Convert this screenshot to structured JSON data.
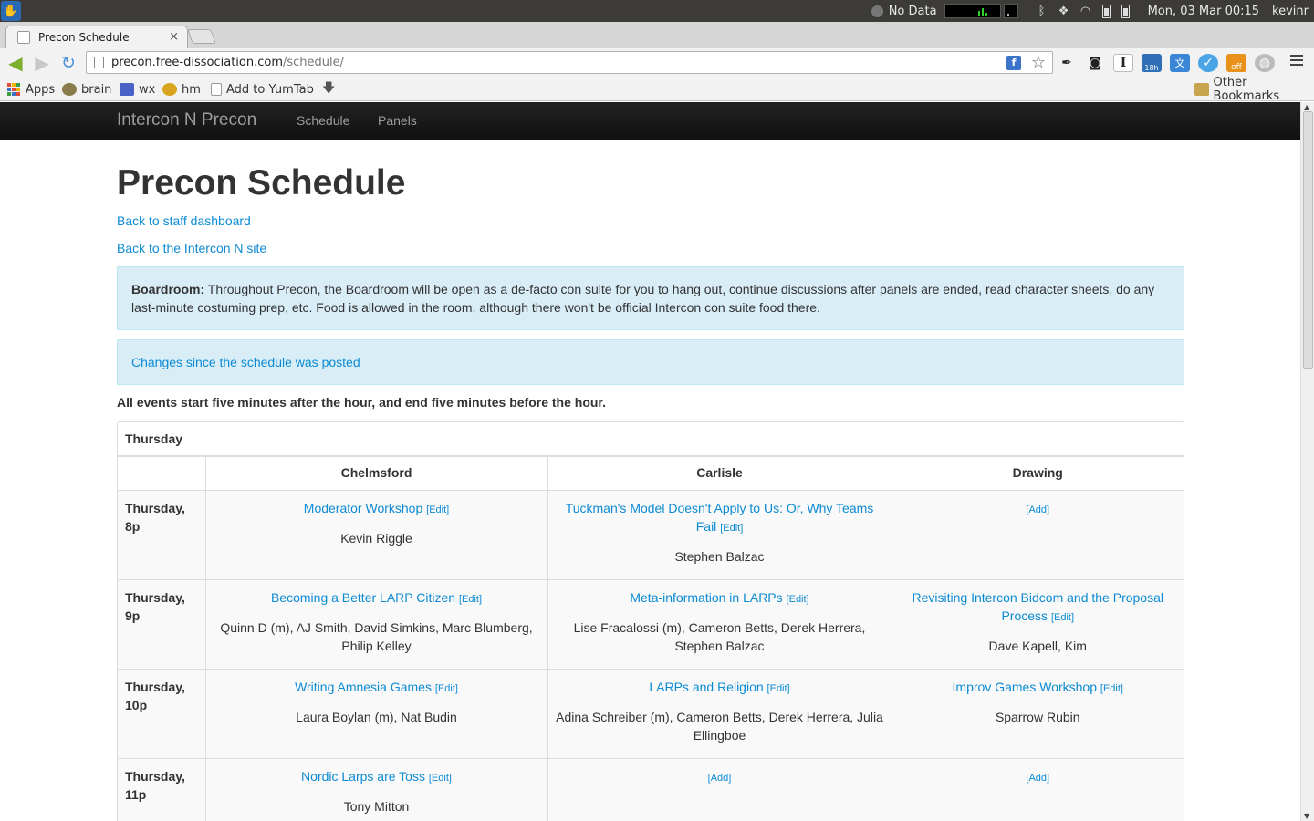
{
  "os_panel": {
    "network_label": "No Data",
    "clock": "Mon, 03 Mar  00:15",
    "user": "kevinr"
  },
  "browser": {
    "tab_title": "Precon Schedule",
    "tab_close": "×",
    "url_host": "precon.free-dissociation.com",
    "url_path": "/schedule/",
    "bookmarks": [
      {
        "label": "Apps",
        "icon": "apps-grid-icon"
      },
      {
        "label": "brain",
        "icon": "brain-icon"
      },
      {
        "label": "wx",
        "icon": "wx-icon"
      },
      {
        "label": "hm",
        "icon": "hm-icon"
      },
      {
        "label": "Add to YumTab",
        "icon": "page-icon"
      }
    ],
    "other_bookmarks": "Other Bookmarks",
    "ext_badges": {
      "calendar": "18h",
      "off": "off"
    }
  },
  "site": {
    "brand": "Intercon N Precon",
    "nav": [
      "Schedule",
      "Panels"
    ]
  },
  "page": {
    "title": "Precon Schedule",
    "back_dashboard": "Back to staff dashboard",
    "back_site": "Back to the Intercon N site",
    "boardroom_label": "Boardroom:",
    "boardroom_text": " Throughout Precon, the Boardroom will be open as a de-facto con suite for you to hang out, continue discussions after panels are ended, read character sheets, do any last-minute costuming prep, etc. Food is allowed in the room, although there won't be official Intercon con suite food there.",
    "changes_link": "Changes since the schedule was posted",
    "note": "All events start five minutes after the hour, and end five minutes before the hour."
  },
  "schedule": {
    "day": "Thursday",
    "rooms": [
      "Chelmsford",
      "Carlisle",
      "Drawing"
    ],
    "edit_label": "[Edit]",
    "add_label": "[Add]",
    "rows": [
      {
        "time_day": "Thursday,",
        "time_hour": "8p",
        "cells": [
          {
            "title": "Moderator Workshop",
            "people": "Kevin Riggle"
          },
          {
            "title": "Tuckman's Model Doesn't Apply to Us: Or, Why Teams Fail",
            "people": "Stephen Balzac"
          },
          null
        ]
      },
      {
        "time_day": "Thursday,",
        "time_hour": "9p",
        "cells": [
          {
            "title": "Becoming a Better LARP Citizen",
            "people": "Quinn D (m), AJ Smith, David Simkins, Marc Blumberg, Philip Kelley"
          },
          {
            "title": "Meta-information in LARPs",
            "people": "Lise Fracalossi (m), Cameron Betts, Derek Herrera, Stephen Balzac"
          },
          {
            "title": "Revisiting Intercon Bidcom and the Proposal Process",
            "people": "Dave Kapell, Kim"
          }
        ]
      },
      {
        "time_day": "Thursday,",
        "time_hour": "10p",
        "cells": [
          {
            "title": "Writing Amnesia Games",
            "people": "Laura Boylan (m), Nat Budin"
          },
          {
            "title": "LARPs and Religion",
            "people": "Adina Schreiber (m), Cameron Betts, Derek Herrera, Julia Ellingboe"
          },
          {
            "title": "Improv Games Workshop",
            "people": "Sparrow Rubin"
          }
        ]
      },
      {
        "time_day": "Thursday,",
        "time_hour": "11p",
        "cells": [
          {
            "title": "Nordic Larps are Toss",
            "people": "Tony Mitton"
          },
          null,
          null
        ]
      }
    ]
  }
}
